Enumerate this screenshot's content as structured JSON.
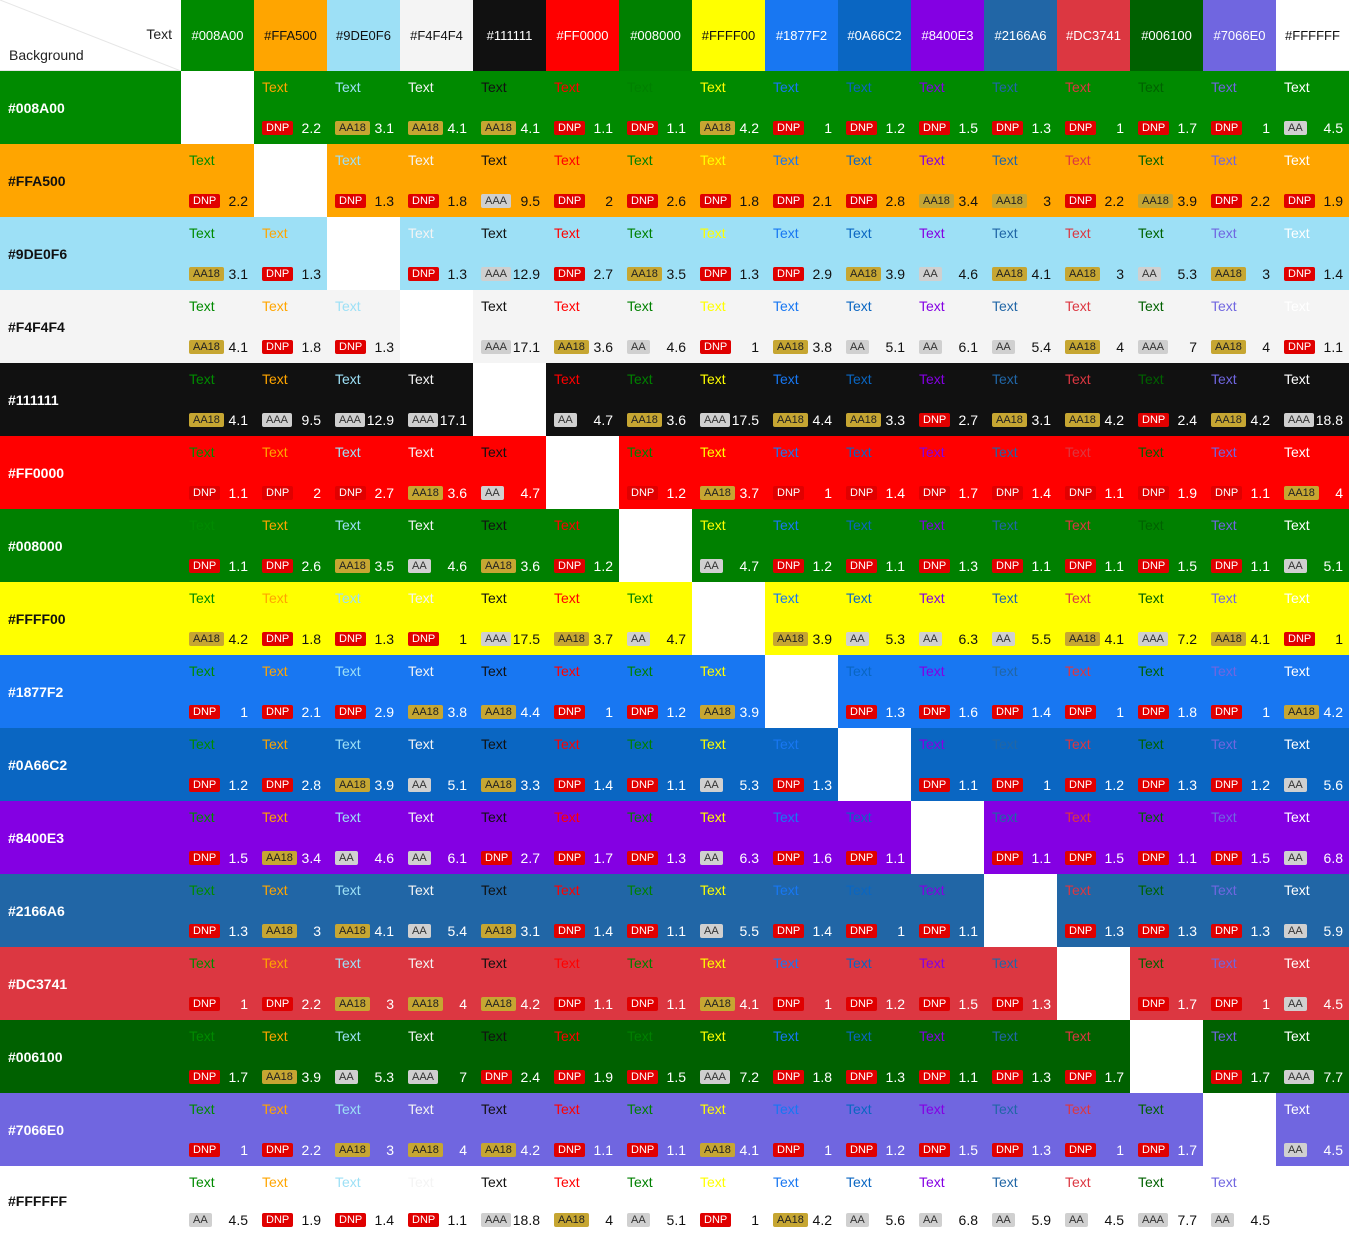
{
  "corner": {
    "text_label": "Text",
    "background_label": "Background"
  },
  "colors": [
    "#008A00",
    "#FFA500",
    "#9DE0F6",
    "#F4F4F4",
    "#111111",
    "#FF0000",
    "#008000",
    "#FFFF00",
    "#1877F2",
    "#0A66C2",
    "#8400E3",
    "#2166A6",
    "#DC3741",
    "#006100",
    "#7066E0",
    "#FFFFFF"
  ],
  "sample_text": "Text",
  "rows": [
    {
      "bg": "#008A00",
      "cells": [
        null,
        [
          "DNP",
          "2.2"
        ],
        [
          "AA18",
          "3.1"
        ],
        [
          "AA18",
          "4.1"
        ],
        [
          "AA18",
          "4.1"
        ],
        [
          "DNP",
          "1.1"
        ],
        [
          "DNP",
          "1.1"
        ],
        [
          "AA18",
          "4.2"
        ],
        [
          "DNP",
          "1"
        ],
        [
          "DNP",
          "1.2"
        ],
        [
          "DNP",
          "1.5"
        ],
        [
          "DNP",
          "1.3"
        ],
        [
          "DNP",
          "1"
        ],
        [
          "DNP",
          "1.7"
        ],
        [
          "DNP",
          "1"
        ],
        [
          "AA",
          "4.5"
        ]
      ]
    },
    {
      "bg": "#FFA500",
      "cells": [
        [
          "DNP",
          "2.2"
        ],
        null,
        [
          "DNP",
          "1.3"
        ],
        [
          "DNP",
          "1.8"
        ],
        [
          "AAA",
          "9.5"
        ],
        [
          "DNP",
          "2"
        ],
        [
          "DNP",
          "2.6"
        ],
        [
          "DNP",
          "1.8"
        ],
        [
          "DNP",
          "2.1"
        ],
        [
          "DNP",
          "2.8"
        ],
        [
          "AA18",
          "3.4"
        ],
        [
          "AA18",
          "3"
        ],
        [
          "DNP",
          "2.2"
        ],
        [
          "AA18",
          "3.9"
        ],
        [
          "DNP",
          "2.2"
        ],
        [
          "DNP",
          "1.9"
        ]
      ]
    },
    {
      "bg": "#9DE0F6",
      "cells": [
        [
          "AA18",
          "3.1"
        ],
        [
          "DNP",
          "1.3"
        ],
        null,
        [
          "DNP",
          "1.3"
        ],
        [
          "AAA",
          "12.9"
        ],
        [
          "DNP",
          "2.7"
        ],
        [
          "AA18",
          "3.5"
        ],
        [
          "DNP",
          "1.3"
        ],
        [
          "DNP",
          "2.9"
        ],
        [
          "AA18",
          "3.9"
        ],
        [
          "AA",
          "4.6"
        ],
        [
          "AA18",
          "4.1"
        ],
        [
          "AA18",
          "3"
        ],
        [
          "AA",
          "5.3"
        ],
        [
          "AA18",
          "3"
        ],
        [
          "DNP",
          "1.4"
        ]
      ]
    },
    {
      "bg": "#F4F4F4",
      "cells": [
        [
          "AA18",
          "4.1"
        ],
        [
          "DNP",
          "1.8"
        ],
        [
          "DNP",
          "1.3"
        ],
        null,
        [
          "AAA",
          "17.1"
        ],
        [
          "AA18",
          "3.6"
        ],
        [
          "AA",
          "4.6"
        ],
        [
          "DNP",
          "1"
        ],
        [
          "AA18",
          "3.8"
        ],
        [
          "AA",
          "5.1"
        ],
        [
          "AA",
          "6.1"
        ],
        [
          "AA",
          "5.4"
        ],
        [
          "AA18",
          "4"
        ],
        [
          "AAA",
          "7"
        ],
        [
          "AA18",
          "4"
        ],
        [
          "DNP",
          "1.1"
        ]
      ]
    },
    {
      "bg": "#111111",
      "cells": [
        [
          "AA18",
          "4.1"
        ],
        [
          "AAA",
          "9.5"
        ],
        [
          "AAA",
          "12.9"
        ],
        [
          "AAA",
          "17.1"
        ],
        null,
        [
          "AA",
          "4.7"
        ],
        [
          "AA18",
          "3.6"
        ],
        [
          "AAA",
          "17.5"
        ],
        [
          "AA18",
          "4.4"
        ],
        [
          "AA18",
          "3.3"
        ],
        [
          "DNP",
          "2.7"
        ],
        [
          "AA18",
          "3.1"
        ],
        [
          "AA18",
          "4.2"
        ],
        [
          "DNP",
          "2.4"
        ],
        [
          "AA18",
          "4.2"
        ],
        [
          "AAA",
          "18.8"
        ]
      ]
    },
    {
      "bg": "#FF0000",
      "cells": [
        [
          "DNP",
          "1.1"
        ],
        [
          "DNP",
          "2"
        ],
        [
          "DNP",
          "2.7"
        ],
        [
          "AA18",
          "3.6"
        ],
        [
          "AA",
          "4.7"
        ],
        null,
        [
          "DNP",
          "1.2"
        ],
        [
          "AA18",
          "3.7"
        ],
        [
          "DNP",
          "1"
        ],
        [
          "DNP",
          "1.4"
        ],
        [
          "DNP",
          "1.7"
        ],
        [
          "DNP",
          "1.4"
        ],
        [
          "DNP",
          "1.1"
        ],
        [
          "DNP",
          "1.9"
        ],
        [
          "DNP",
          "1.1"
        ],
        [
          "AA18",
          "4"
        ]
      ]
    },
    {
      "bg": "#008000",
      "cells": [
        [
          "DNP",
          "1.1"
        ],
        [
          "DNP",
          "2.6"
        ],
        [
          "AA18",
          "3.5"
        ],
        [
          "AA",
          "4.6"
        ],
        [
          "AA18",
          "3.6"
        ],
        [
          "DNP",
          "1.2"
        ],
        null,
        [
          "AA",
          "4.7"
        ],
        [
          "DNP",
          "1.2"
        ],
        [
          "DNP",
          "1.1"
        ],
        [
          "DNP",
          "1.3"
        ],
        [
          "DNP",
          "1.1"
        ],
        [
          "DNP",
          "1.1"
        ],
        [
          "DNP",
          "1.5"
        ],
        [
          "DNP",
          "1.1"
        ],
        [
          "AA",
          "5.1"
        ]
      ]
    },
    {
      "bg": "#FFFF00",
      "cells": [
        [
          "AA18",
          "4.2"
        ],
        [
          "DNP",
          "1.8"
        ],
        [
          "DNP",
          "1.3"
        ],
        [
          "DNP",
          "1"
        ],
        [
          "AAA",
          "17.5"
        ],
        [
          "AA18",
          "3.7"
        ],
        [
          "AA",
          "4.7"
        ],
        null,
        [
          "AA18",
          "3.9"
        ],
        [
          "AA",
          "5.3"
        ],
        [
          "AA",
          "6.3"
        ],
        [
          "AA",
          "5.5"
        ],
        [
          "AA18",
          "4.1"
        ],
        [
          "AAA",
          "7.2"
        ],
        [
          "AA18",
          "4.1"
        ],
        [
          "DNP",
          "1"
        ]
      ]
    },
    {
      "bg": "#1877F2",
      "cells": [
        [
          "DNP",
          "1"
        ],
        [
          "DNP",
          "2.1"
        ],
        [
          "DNP",
          "2.9"
        ],
        [
          "AA18",
          "3.8"
        ],
        [
          "AA18",
          "4.4"
        ],
        [
          "DNP",
          "1"
        ],
        [
          "DNP",
          "1.2"
        ],
        [
          "AA18",
          "3.9"
        ],
        null,
        [
          "DNP",
          "1.3"
        ],
        [
          "DNP",
          "1.6"
        ],
        [
          "DNP",
          "1.4"
        ],
        [
          "DNP",
          "1"
        ],
        [
          "DNP",
          "1.8"
        ],
        [
          "DNP",
          "1"
        ],
        [
          "AA18",
          "4.2"
        ]
      ]
    },
    {
      "bg": "#0A66C2",
      "cells": [
        [
          "DNP",
          "1.2"
        ],
        [
          "DNP",
          "2.8"
        ],
        [
          "AA18",
          "3.9"
        ],
        [
          "AA",
          "5.1"
        ],
        [
          "AA18",
          "3.3"
        ],
        [
          "DNP",
          "1.4"
        ],
        [
          "DNP",
          "1.1"
        ],
        [
          "AA",
          "5.3"
        ],
        [
          "DNP",
          "1.3"
        ],
        null,
        [
          "DNP",
          "1.1"
        ],
        [
          "DNP",
          "1"
        ],
        [
          "DNP",
          "1.2"
        ],
        [
          "DNP",
          "1.3"
        ],
        [
          "DNP",
          "1.2"
        ],
        [
          "AA",
          "5.6"
        ]
      ]
    },
    {
      "bg": "#8400E3",
      "cells": [
        [
          "DNP",
          "1.5"
        ],
        [
          "AA18",
          "3.4"
        ],
        [
          "AA",
          "4.6"
        ],
        [
          "AA",
          "6.1"
        ],
        [
          "DNP",
          "2.7"
        ],
        [
          "DNP",
          "1.7"
        ],
        [
          "DNP",
          "1.3"
        ],
        [
          "AA",
          "6.3"
        ],
        [
          "DNP",
          "1.6"
        ],
        [
          "DNP",
          "1.1"
        ],
        null,
        [
          "DNP",
          "1.1"
        ],
        [
          "DNP",
          "1.5"
        ],
        [
          "DNP",
          "1.1"
        ],
        [
          "DNP",
          "1.5"
        ],
        [
          "AA",
          "6.8"
        ]
      ]
    },
    {
      "bg": "#2166A6",
      "cells": [
        [
          "DNP",
          "1.3"
        ],
        [
          "AA18",
          "3"
        ],
        [
          "AA18",
          "4.1"
        ],
        [
          "AA",
          "5.4"
        ],
        [
          "AA18",
          "3.1"
        ],
        [
          "DNP",
          "1.4"
        ],
        [
          "DNP",
          "1.1"
        ],
        [
          "AA",
          "5.5"
        ],
        [
          "DNP",
          "1.4"
        ],
        [
          "DNP",
          "1"
        ],
        [
          "DNP",
          "1.1"
        ],
        null,
        [
          "DNP",
          "1.3"
        ],
        [
          "DNP",
          "1.3"
        ],
        [
          "DNP",
          "1.3"
        ],
        [
          "AA",
          "5.9"
        ]
      ]
    },
    {
      "bg": "#DC3741",
      "cells": [
        [
          "DNP",
          "1"
        ],
        [
          "DNP",
          "2.2"
        ],
        [
          "AA18",
          "3"
        ],
        [
          "AA18",
          "4"
        ],
        [
          "AA18",
          "4.2"
        ],
        [
          "DNP",
          "1.1"
        ],
        [
          "DNP",
          "1.1"
        ],
        [
          "AA18",
          "4.1"
        ],
        [
          "DNP",
          "1"
        ],
        [
          "DNP",
          "1.2"
        ],
        [
          "DNP",
          "1.5"
        ],
        [
          "DNP",
          "1.3"
        ],
        null,
        [
          "DNP",
          "1.7"
        ],
        [
          "DNP",
          "1"
        ],
        [
          "AA",
          "4.5"
        ]
      ]
    },
    {
      "bg": "#006100",
      "cells": [
        [
          "DNP",
          "1.7"
        ],
        [
          "AA18",
          "3.9"
        ],
        [
          "AA",
          "5.3"
        ],
        [
          "AAA",
          "7"
        ],
        [
          "DNP",
          "2.4"
        ],
        [
          "DNP",
          "1.9"
        ],
        [
          "DNP",
          "1.5"
        ],
        [
          "AAA",
          "7.2"
        ],
        [
          "DNP",
          "1.8"
        ],
        [
          "DNP",
          "1.3"
        ],
        [
          "DNP",
          "1.1"
        ],
        [
          "DNP",
          "1.3"
        ],
        [
          "DNP",
          "1.7"
        ],
        null,
        [
          "DNP",
          "1.7"
        ],
        [
          "AAA",
          "7.7"
        ]
      ]
    },
    {
      "bg": "#7066E0",
      "cells": [
        [
          "DNP",
          "1"
        ],
        [
          "DNP",
          "2.2"
        ],
        [
          "AA18",
          "3"
        ],
        [
          "AA18",
          "4"
        ],
        [
          "AA18",
          "4.2"
        ],
        [
          "DNP",
          "1.1"
        ],
        [
          "DNP",
          "1.1"
        ],
        [
          "AA18",
          "4.1"
        ],
        [
          "DNP",
          "1"
        ],
        [
          "DNP",
          "1.2"
        ],
        [
          "DNP",
          "1.5"
        ],
        [
          "DNP",
          "1.3"
        ],
        [
          "DNP",
          "1"
        ],
        [
          "DNP",
          "1.7"
        ],
        null,
        [
          "AA",
          "4.5"
        ]
      ]
    },
    {
      "bg": "#FFFFFF",
      "cells": [
        [
          "AA",
          "4.5"
        ],
        [
          "DNP",
          "1.9"
        ],
        [
          "DNP",
          "1.4"
        ],
        [
          "DNP",
          "1.1"
        ],
        [
          "AAA",
          "18.8"
        ],
        [
          "AA18",
          "4"
        ],
        [
          "AA",
          "5.1"
        ],
        [
          "DNP",
          "1"
        ],
        [
          "AA18",
          "4.2"
        ],
        [
          "AA",
          "5.6"
        ],
        [
          "AA",
          "6.8"
        ],
        [
          "AA",
          "5.9"
        ],
        [
          "AA",
          "4.5"
        ],
        [
          "AAA",
          "7.7"
        ],
        [
          "AA",
          "4.5"
        ],
        null
      ]
    }
  ]
}
